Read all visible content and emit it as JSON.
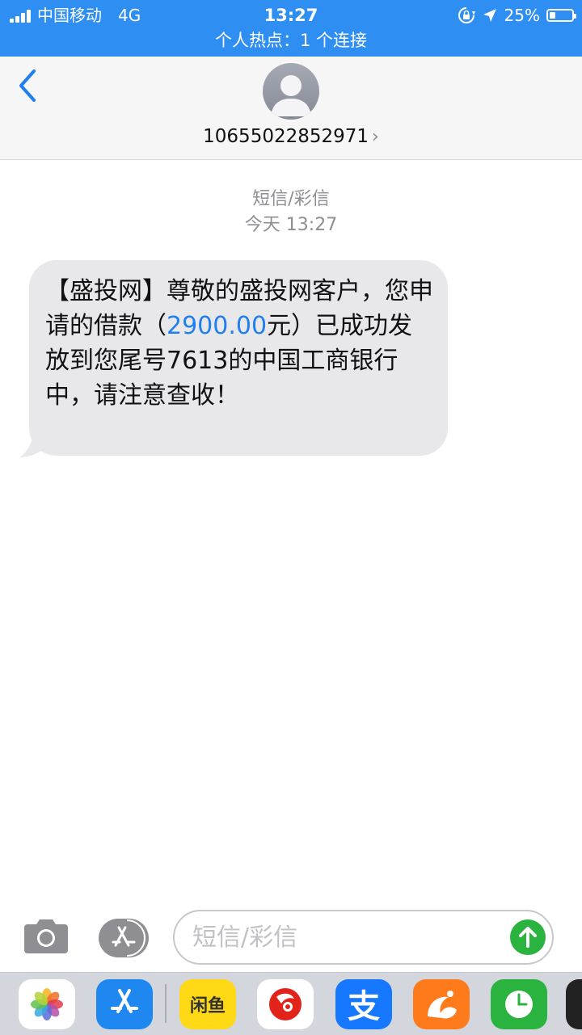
{
  "status_bar": {
    "carrier": "中国移动",
    "network": "4G",
    "time": "13:27",
    "battery": "25%",
    "battery_level": 0.25,
    "hotspot": "个人热点：1 个连接"
  },
  "header": {
    "contact": "10655022852971",
    "chevron": "›"
  },
  "thread": {
    "label": "短信/彩信",
    "timestamp": "今天 13:27",
    "message": {
      "part1": "【盛投网】尊敬的盛投网客户，您申请的借款（",
      "amount": "2900.00",
      "part2": "元）已成功发放到您尾号7613的中国工商银行中，请注意查收！"
    }
  },
  "input_bar": {
    "placeholder": "短信/彩信"
  },
  "app_drawer": {
    "apps": [
      "photos-app",
      "app-store-app",
      "xianyu-app",
      "pinduoduo-app",
      "alipay-app",
      "uc-browser-app",
      "clock-app",
      "more-app"
    ],
    "xianyu_label": "闲鱼",
    "alipay_label": "支"
  },
  "colors": {
    "status_bar": "#2f8ef2",
    "link_blue": "#1f7ff0",
    "bubble": "#e8e8ea",
    "send_green": "#2bb33f"
  }
}
